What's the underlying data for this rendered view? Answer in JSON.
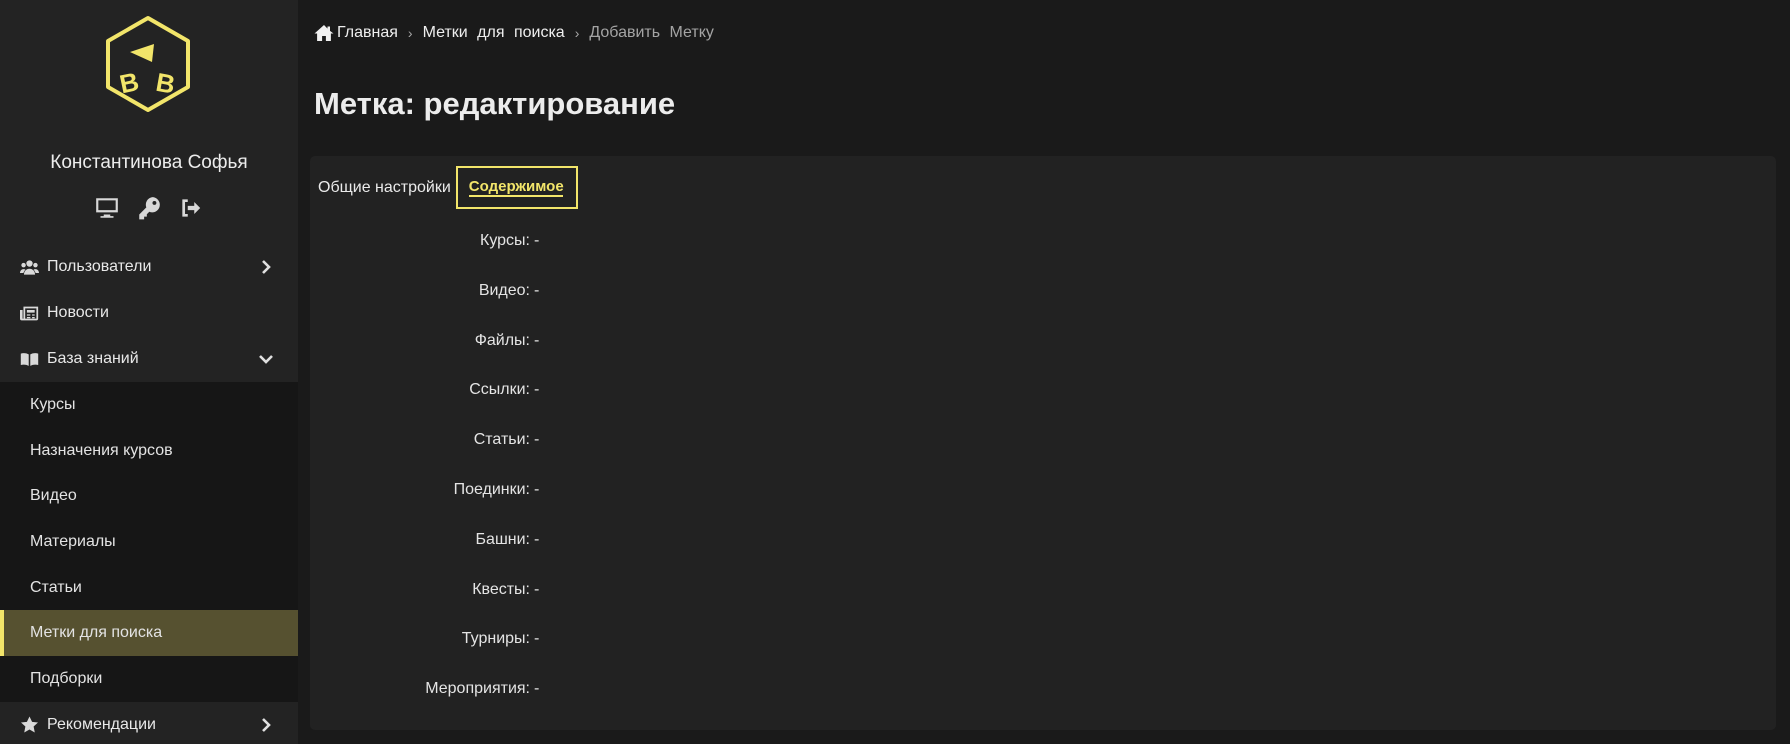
{
  "sidebar": {
    "logo_icon": "cube-logo-icon",
    "user_name": "Константинова Софья",
    "user_actions": [
      {
        "icon": "monitor-icon"
      },
      {
        "icon": "key-icon"
      },
      {
        "icon": "logout-icon"
      }
    ],
    "nav": {
      "users": {
        "label": "Пользователи",
        "icon": "users-icon",
        "chevron": "chevron-right-icon"
      },
      "news": {
        "label": "Новости",
        "icon": "newspaper-icon"
      },
      "knowledge_base": {
        "label": "База знаний",
        "icon": "book-icon",
        "chevron": "chevron-down-icon",
        "expanded": true
      },
      "knowledge_items": [
        {
          "label": "Курсы"
        },
        {
          "label": "Назначения курсов"
        },
        {
          "label": "Видео"
        },
        {
          "label": "Материалы"
        },
        {
          "label": "Статьи"
        },
        {
          "label": "Метки для поиска",
          "active": true
        },
        {
          "label": "Подборки"
        }
      ],
      "recommendations": {
        "label": "Рекомендации",
        "icon": "star-icon",
        "chevron": "chevron-right-icon"
      }
    }
  },
  "breadcrumb": {
    "home_icon": "home-icon",
    "home": "Главная",
    "section": "Метки для поиска",
    "current": "Добавить Метку",
    "separator": "›"
  },
  "page_title": "Метка: редактирование",
  "tabs": {
    "general": "Общие настройки",
    "content": "Содержимое",
    "active": "content"
  },
  "fields": [
    {
      "label": "Курсы:",
      "value": "-"
    },
    {
      "label": "Видео:",
      "value": "-"
    },
    {
      "label": "Файлы:",
      "value": "-"
    },
    {
      "label": "Ссылки:",
      "value": "-"
    },
    {
      "label": "Статьи:",
      "value": "-"
    },
    {
      "label": "Поединки:",
      "value": "-"
    },
    {
      "label": "Башни:",
      "value": "-"
    },
    {
      "label": "Квесты:",
      "value": "-"
    },
    {
      "label": "Турниры:",
      "value": "-"
    },
    {
      "label": "Мероприятия:",
      "value": "-"
    }
  ],
  "colors": {
    "accent": "#f2e56a",
    "background": "#1a1a1a",
    "sidebar": "#232323",
    "active_item": "#565130"
  }
}
